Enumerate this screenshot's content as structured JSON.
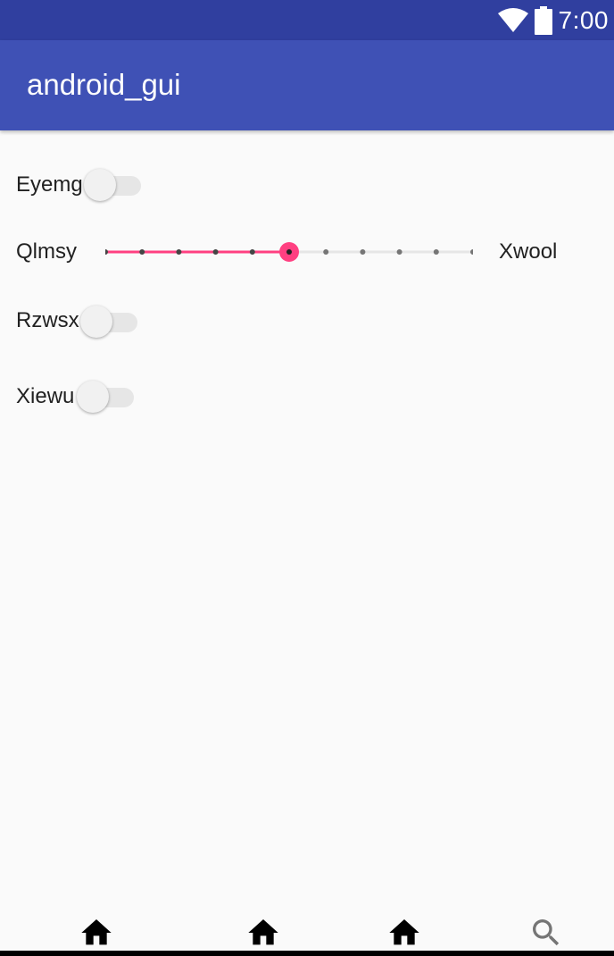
{
  "status_bar": {
    "time": "7:00",
    "icons": [
      "wifi-icon",
      "battery-icon"
    ],
    "background": "#303f9f"
  },
  "app_bar": {
    "title": "android_gui",
    "background": "#3f51b5"
  },
  "rows": [
    {
      "label": "Eyemg",
      "type": "switch",
      "checked": false
    },
    {
      "label": "Qlmsy",
      "type": "slider",
      "end_label": "Xwool",
      "min": 0,
      "max": 10,
      "value": 5,
      "ticks": 11
    },
    {
      "label": "Rzwsx",
      "type": "switch",
      "checked": false
    },
    {
      "label": "Xiewu",
      "type": "switch",
      "checked": false
    }
  ],
  "accent_color": "#ff4081",
  "bottom_nav": {
    "items": [
      {
        "icon": "home-icon"
      },
      {
        "icon": "home-icon"
      },
      {
        "icon": "home-icon"
      },
      {
        "icon": "search-icon"
      }
    ]
  }
}
